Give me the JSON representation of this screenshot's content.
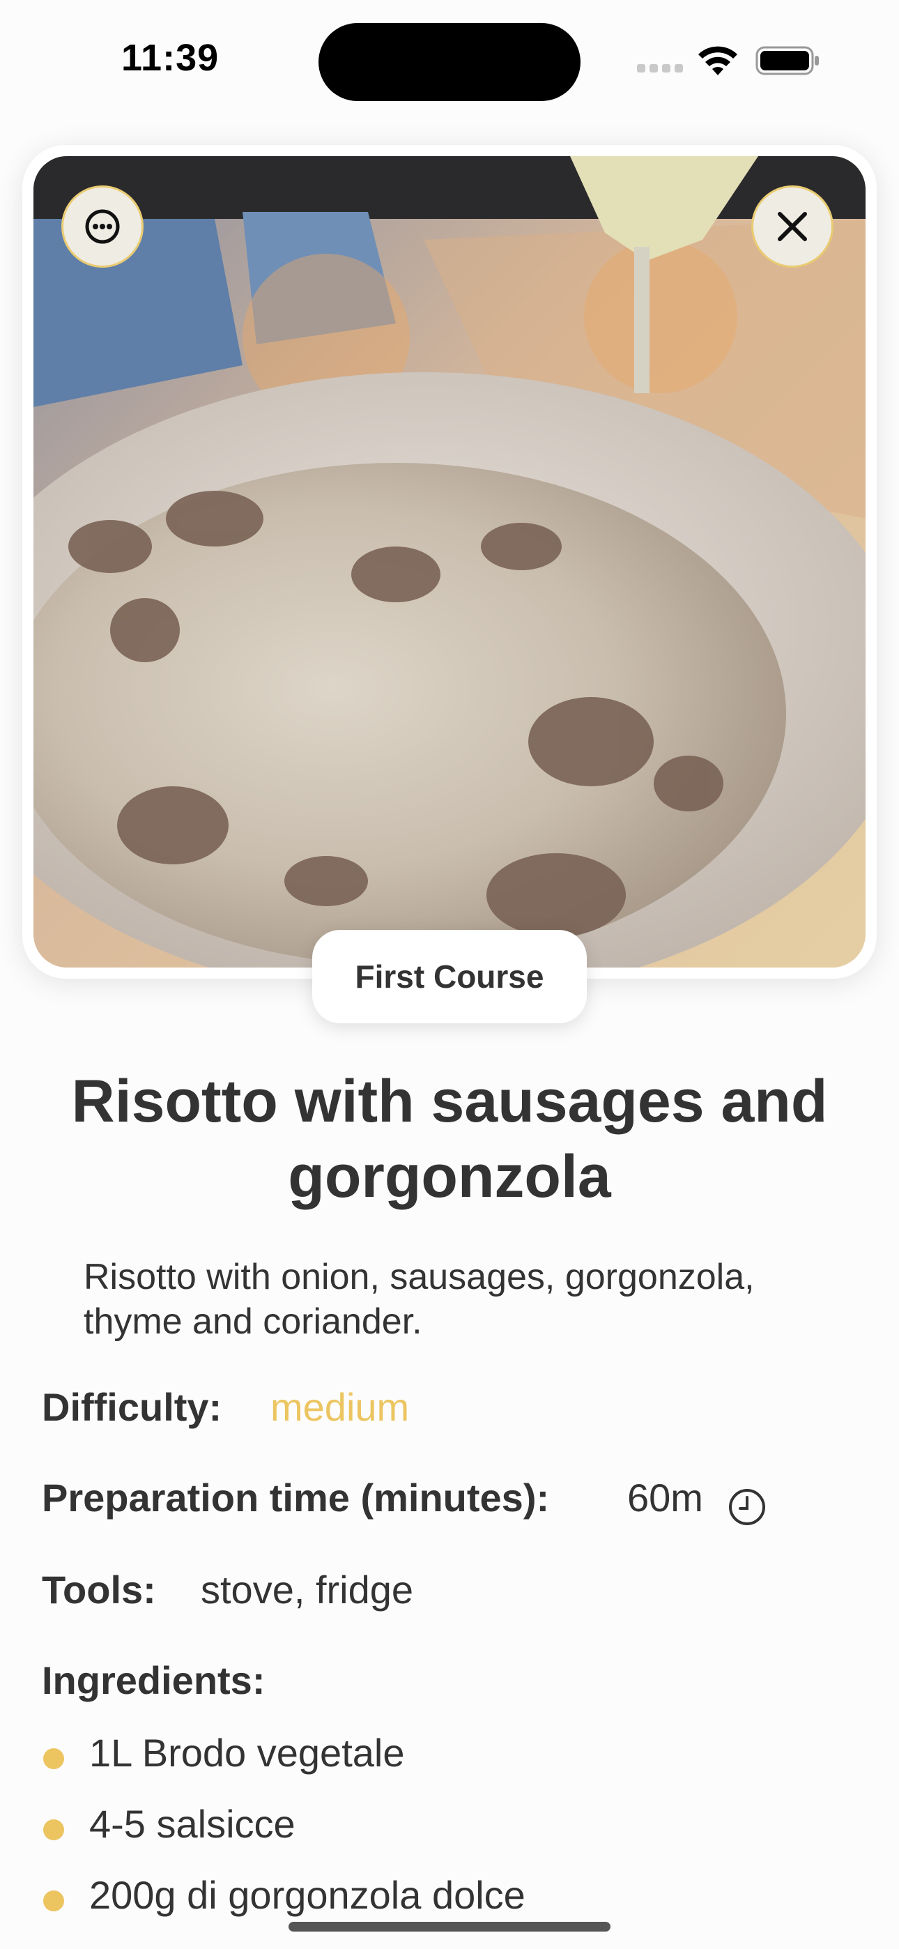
{
  "status_bar": {
    "time": "11:39"
  },
  "actions": {
    "more_icon": "ellipsis-circle-icon",
    "close_icon": "close-icon"
  },
  "recipe": {
    "category": "First Course",
    "title": "Risotto with sausages and gorgonzola",
    "description": "Risotto with onion, sausages, gorgonzola, thyme and coriander.",
    "difficulty_label": "Difficulty:",
    "difficulty_value": "medium",
    "prep_label": "Preparation time (minutes):",
    "prep_value": "60m",
    "tools_label": "Tools:",
    "tools_value": "stove, fridge",
    "ingredients_label": "Ingredients:",
    "ingredients": [
      "1L Brodo vegetale",
      "4-5 salsicce",
      "200g di gorgonzola dolce"
    ]
  },
  "colors": {
    "accent": "#ecc561",
    "text": "#333333"
  }
}
